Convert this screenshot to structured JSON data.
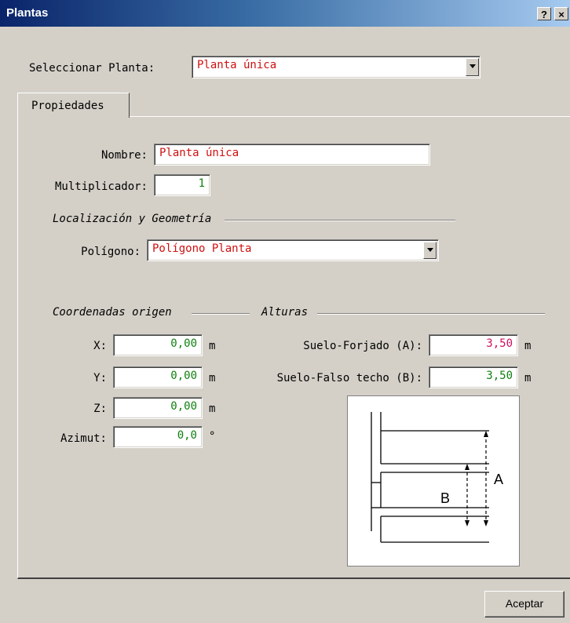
{
  "window": {
    "title": "Plantas",
    "help_label": "?",
    "close_label": "×"
  },
  "planta": {
    "label": "Seleccionar Planta:",
    "value": "Planta única"
  },
  "tabs": [
    {
      "label": "Propiedades"
    }
  ],
  "props": {
    "nombre_label": "Nombre:",
    "nombre_value": "Planta única",
    "mult_label": "Multiplicador:",
    "mult_value": "1"
  },
  "loc": {
    "heading": "Localización y Geometría",
    "poly_label": "Polígono:",
    "poly_value": "Polígono Planta"
  },
  "coords": {
    "heading": "Coordenadas origen",
    "x_label": "X:",
    "x_value": "0,00",
    "x_unit": "m",
    "y_label": "Y:",
    "y_value": "0,00",
    "y_unit": "m",
    "z_label": "Z:",
    "z_value": "0,00",
    "z_unit": "m",
    "az_label": "Azimut:",
    "az_value": "0,0",
    "az_unit": "°"
  },
  "alturas": {
    "heading": "Alturas",
    "a_label": "Suelo-Forjado (A):",
    "a_value": "3,50",
    "a_unit": "m",
    "b_label": "Suelo-Falso techo (B):",
    "b_value": "3,50",
    "b_unit": "m"
  },
  "diagram": {
    "label_a": "A",
    "label_b": "B"
  },
  "footer": {
    "accept_label": "Aceptar"
  },
  "colors": {
    "titlebar": "#0a246a",
    "face": "#d4d0c8",
    "value_red": "#d01010",
    "value_green": "#108010"
  }
}
